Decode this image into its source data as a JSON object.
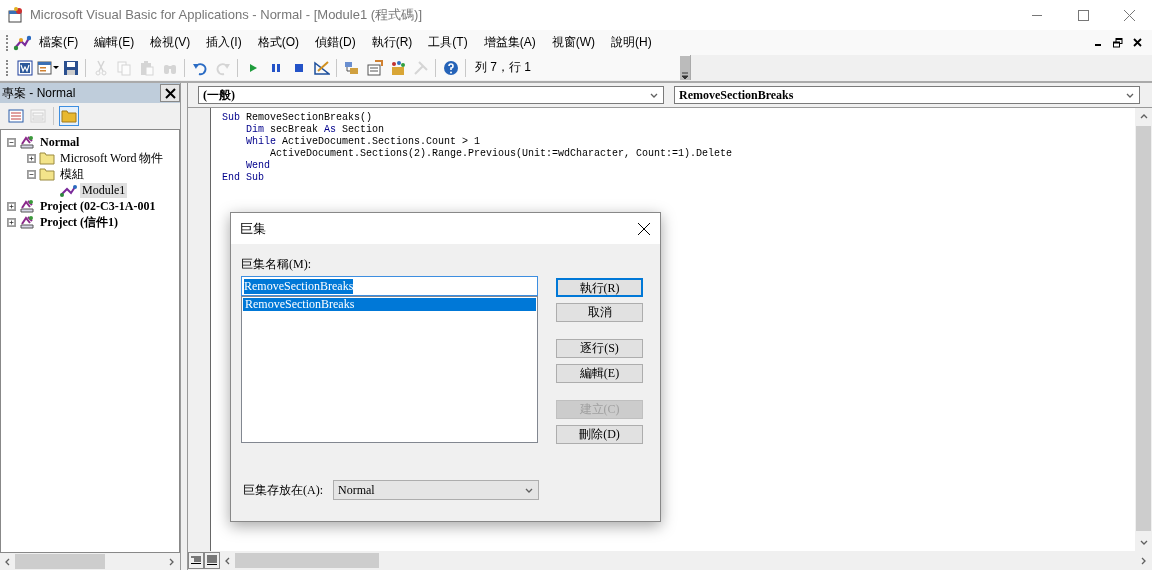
{
  "window": {
    "title": "Microsoft Visual Basic for Applications - Normal - [Module1 (程式碼)]"
  },
  "menu": [
    "檔案(F)",
    "編輯(E)",
    "檢視(V)",
    "插入(I)",
    "格式(O)",
    "偵錯(D)",
    "執行(R)",
    "工具(T)",
    "增益集(A)",
    "視窗(W)",
    "說明(H)"
  ],
  "toolbar": {
    "buttons": [
      {
        "kind": "word",
        "disabled": false
      },
      {
        "kind": "userform",
        "disabled": false
      },
      {
        "kind": "save",
        "disabled": false
      },
      {
        "kind": "separator"
      },
      {
        "kind": "cut",
        "disabled": true
      },
      {
        "kind": "copy",
        "disabled": true
      },
      {
        "kind": "paste",
        "disabled": true
      },
      {
        "kind": "find",
        "disabled": true
      },
      {
        "kind": "separator"
      },
      {
        "kind": "undo",
        "disabled": false
      },
      {
        "kind": "redo",
        "disabled": true
      },
      {
        "kind": "separator"
      },
      {
        "kind": "run",
        "disabled": false
      },
      {
        "kind": "pause",
        "disabled": false
      },
      {
        "kind": "stop",
        "disabled": false
      },
      {
        "kind": "design",
        "disabled": false
      },
      {
        "kind": "separator"
      },
      {
        "kind": "explorer",
        "disabled": false
      },
      {
        "kind": "properties",
        "disabled": false
      },
      {
        "kind": "objects",
        "disabled": false
      },
      {
        "kind": "tools",
        "disabled": true
      },
      {
        "kind": "separator"
      },
      {
        "kind": "help",
        "disabled": false
      }
    ],
    "position": "列 7，行 1"
  },
  "project": {
    "title": "專案 - Normal",
    "buttons": [
      {
        "kind": "view-code",
        "disabled": false
      },
      {
        "kind": "view-object",
        "disabled": true
      },
      {
        "kind": "toggle-folders",
        "disabled": false
      }
    ],
    "tree": [
      {
        "label": "Normal",
        "kind": "project",
        "expanded": true,
        "selected": false,
        "children": [
          {
            "label": "Microsoft Word 物件",
            "kind": "folder",
            "expanded": false,
            "selected": false
          },
          {
            "label": "模組",
            "kind": "folder",
            "expanded": true,
            "selected": false,
            "children": [
              {
                "label": "Module1",
                "kind": "module",
                "selected": true
              }
            ]
          }
        ]
      },
      {
        "label": "Project (02-C3-1A-001",
        "kind": "project",
        "expanded": false,
        "selected": false
      },
      {
        "label": "Project (信件1)",
        "kind": "project",
        "expanded": false,
        "selected": false
      }
    ]
  },
  "code": {
    "object_box": "(一般)",
    "procedure_box": "RemoveSectionBreaks",
    "lines": [
      [
        {
          "text": "Sub",
          "kind": "keyword"
        },
        {
          "text": " RemoveSectionBreaks()",
          "kind": "plain"
        }
      ],
      [
        {
          "text": "    Dim",
          "kind": "keyword"
        },
        {
          "text": " secBreak ",
          "kind": "plain"
        },
        {
          "text": "As",
          "kind": "keyword"
        },
        {
          "text": " Section",
          "kind": "plain"
        }
      ],
      [
        {
          "text": "    While",
          "kind": "keyword"
        },
        {
          "text": " ActiveDocument.Sections.Count > 1",
          "kind": "plain"
        }
      ],
      [
        {
          "text": "        ActiveDocument.Sections(2).Range.Previous(Unit:=wdCharacter, Count:=1).Delete",
          "kind": "plain"
        }
      ],
      [
        {
          "text": "    Wend",
          "kind": "keyword"
        }
      ],
      [
        {
          "text": "End Sub",
          "kind": "keyword"
        }
      ]
    ]
  },
  "dialog": {
    "title": "巨集",
    "name_label": "巨集名稱(M):",
    "name_value": "RemoveSectionBreaks",
    "macros": [
      {
        "name": "RemoveSectionBreaks",
        "selected": true
      }
    ],
    "buttons": [
      {
        "label": "執行(R)",
        "default": true,
        "disabled": false
      },
      {
        "label": "取消",
        "default": false,
        "disabled": false
      },
      {
        "label": "逐行(S)",
        "default": false,
        "disabled": false
      },
      {
        "label": "編輯(E)",
        "default": false,
        "disabled": false
      },
      {
        "label": "建立(C)",
        "default": false,
        "disabled": true
      },
      {
        "label": "刪除(D)",
        "default": false,
        "disabled": false
      }
    ],
    "location_label": "巨集存放在(A):",
    "location": "Normal"
  }
}
